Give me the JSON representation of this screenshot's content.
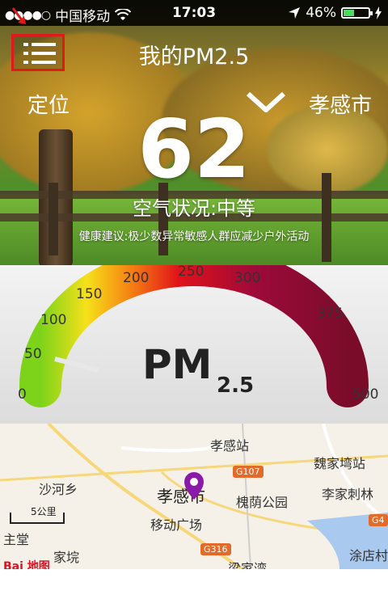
{
  "status_bar": {
    "signal": "●●●●○",
    "carrier": "中国移动",
    "time": "17:03",
    "battery": "46%",
    "battery_level": 0.46
  },
  "header": {
    "title": "我的PM2.5",
    "locate_label": "定位",
    "city": "孝感市"
  },
  "air": {
    "aqi": "62",
    "status": "空气状况:中等",
    "advice": "健康建议:极少数异常敏感人群应减少户外活动"
  },
  "gauge": {
    "ticks": [
      "0",
      "50",
      "100",
      "150",
      "200",
      "250",
      "300",
      "375",
      "500"
    ],
    "label_main": "PM",
    "label_sub": "2.5",
    "value": 62
  },
  "map": {
    "labels": {
      "station": "孝感站",
      "weijiating": "魏家塆站",
      "shahexiang": "沙河乡",
      "city": "孝感市",
      "park": "槐荫公园",
      "lijia": "李家刺林",
      "square": "移动广场",
      "zhutang": "主堂",
      "jiahuan": "家垸",
      "tudian": "涂店村",
      "liangjia": "梁家湾",
      "g107": "G107",
      "g316": "G316",
      "g4": "G4"
    },
    "scale": "5公里",
    "logo": "Bai 地图"
  },
  "colors": {
    "menu_border": "#e01a1a",
    "gauge_low": "#7cd31a",
    "gauge_high": "#7a0c2a"
  }
}
